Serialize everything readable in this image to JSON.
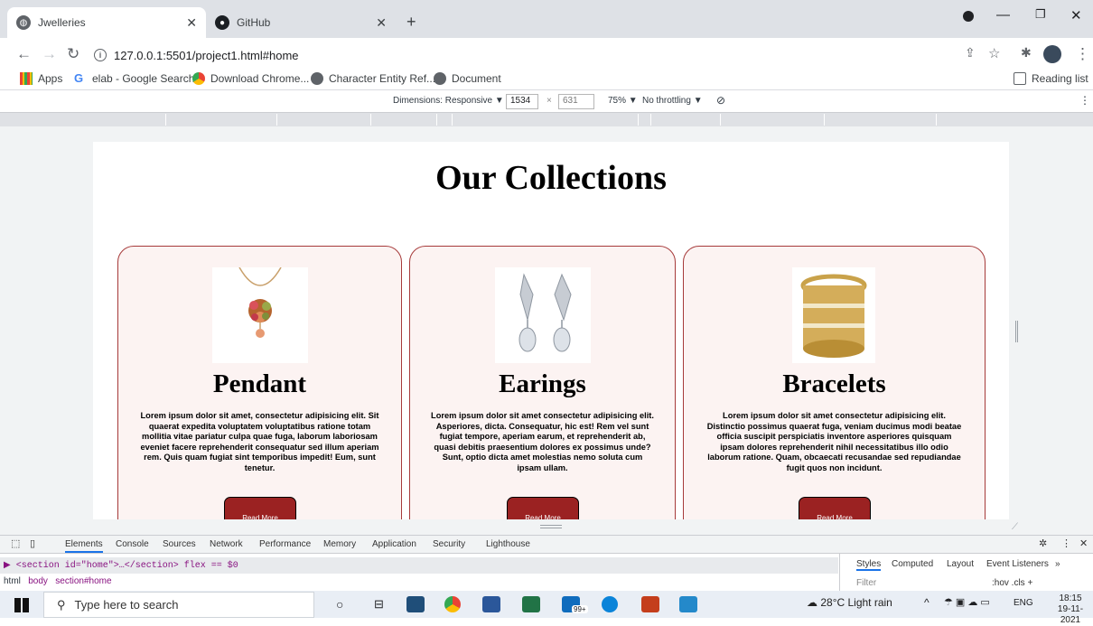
{
  "browser": {
    "tabs": [
      {
        "label": "Jwelleries",
        "active": true
      },
      {
        "label": "GitHub",
        "active": false
      }
    ],
    "new_tab": "+",
    "url": "127.0.0.1:5501/project1.html#home",
    "bookmarks": [
      "Apps",
      "elab - Google Search",
      "Download Chrome...",
      "Character Entity Ref...",
      "Document"
    ],
    "reading_list": "Reading list"
  },
  "device_toolbar": {
    "dimensions_label": "Dimensions: Responsive ▼",
    "width": "1534",
    "times": "×",
    "height": "631",
    "zoom": "75% ▼",
    "throttling": "No throttling ▼"
  },
  "page": {
    "heading": "Our Collections",
    "cards": [
      {
        "title": "Pendant",
        "text": "Lorem ipsum dolor sit amet, consectetur adipisicing elit. Sit quaerat expedita voluptatem voluptatibus ratione totam mollitia vitae pariatur culpa quae fuga, laborum laboriosam eveniet facere reprehenderit consequatur sed illum aperiam rem. Quis quam fugiat sint temporibus impedit! Eum, sunt tenetur.",
        "button": "Read More"
      },
      {
        "title": "Earings",
        "text": "Lorem ipsum dolor sit amet consectetur adipisicing elit. Asperiores, dicta. Consequatur, hic est! Rem vel sunt fugiat tempore, aperiam earum, et reprehenderit ab, quasi debitis praesentium dolores ex possimus unde? Sunt, optio dicta amet molestias nemo soluta cum ipsam ullam.",
        "button": "Read More"
      },
      {
        "title": "Bracelets",
        "text": "Lorem ipsum dolor sit amet consectetur adipisicing elit. Distinctio possimus quaerat fuga, veniam ducimus modi beatae officia suscipit perspiciatis inventore asperiores quisquam ipsam dolores reprehenderit nihil necessitatibus illo odio laborum ratione. Quam, obcaecati recusandae sed repudiandae fugit quos non incidunt.",
        "button": "Read More"
      }
    ]
  },
  "devtools": {
    "tabs": [
      "Elements",
      "Console",
      "Sources",
      "Network",
      "Performance",
      "Memory",
      "Application",
      "Security",
      "Lighthouse"
    ],
    "selected_tab": "Elements",
    "dom_line": "▶ <section id=\"home\">…</section> flex == $0",
    "breadcrumbs": [
      "html",
      "body",
      "section#home"
    ],
    "style_tabs": [
      "Styles",
      "Computed",
      "Layout",
      "Event Listeners",
      "»"
    ],
    "filter_placeholder": "Filter",
    "filter_tools": ":hov .cls +"
  },
  "taskbar": {
    "search_placeholder": "Type here to search",
    "weather": "28°C Light rain",
    "language": "ENG",
    "time": "18:15",
    "date": "19-11-2021",
    "badge": "99+"
  }
}
